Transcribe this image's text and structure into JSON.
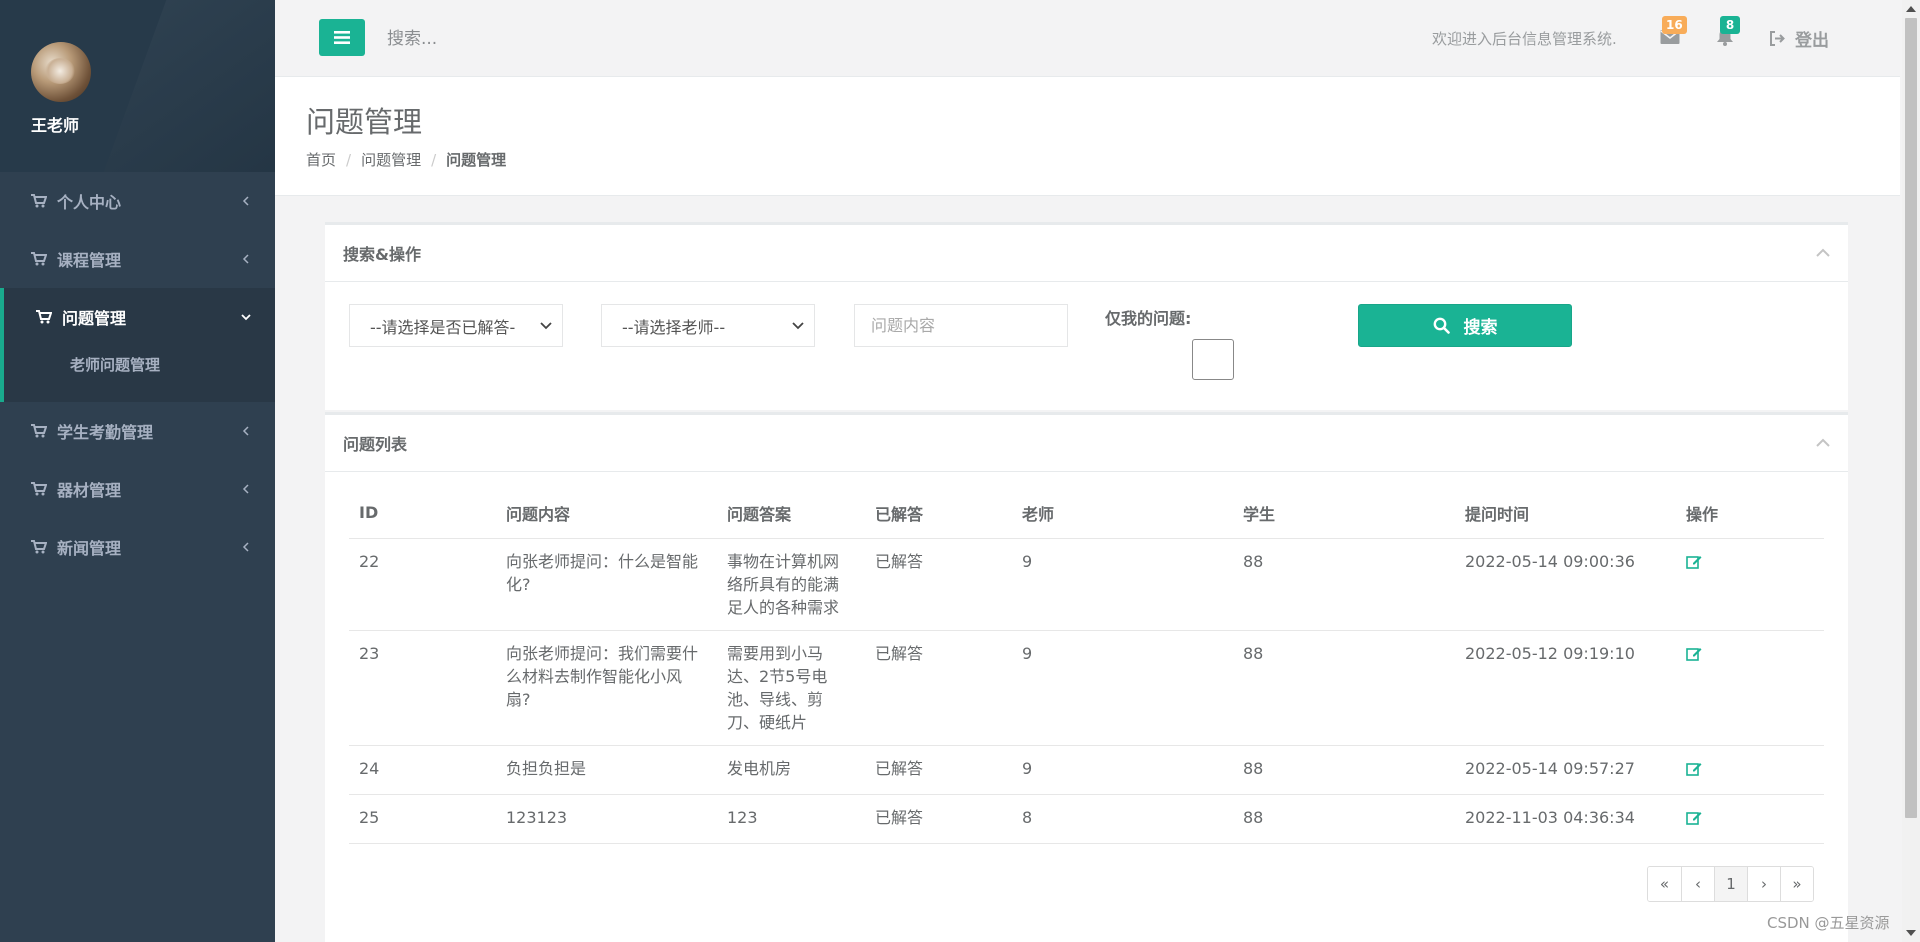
{
  "sidebar": {
    "user_name": "王老师",
    "items": [
      {
        "label": "个人中心"
      },
      {
        "label": "课程管理"
      },
      {
        "label": "问题管理"
      },
      {
        "label": "学生考勤管理"
      },
      {
        "label": "器材管理"
      },
      {
        "label": "新闻管理"
      }
    ],
    "active_sub": "老师问题管理"
  },
  "topbar": {
    "search_placeholder": "搜索...",
    "welcome": "欢迎进入后台信息管理系统.",
    "mail_count": "16",
    "notify_count": "8",
    "logout": "登出"
  },
  "heading": {
    "title": "问题管理",
    "breadcrumb": [
      "首页",
      "问题管理",
      "问题管理"
    ]
  },
  "search_panel": {
    "title": "搜索&操作",
    "answered_select": "--请选择是否已解答-",
    "teacher_select": "--请选择老师--",
    "content_placeholder": "问题内容",
    "only_mine_label": "仅我的问题:",
    "search_button": "搜索"
  },
  "list_panel": {
    "title": "问题列表",
    "columns": [
      "ID",
      "问题内容",
      "问题答案",
      "已解答",
      "老师",
      "学生",
      "提问时间",
      "操作"
    ],
    "rows": [
      {
        "id": "22",
        "question": "向张老师提问：什么是智能化?",
        "answer": "事物在计算机网络所具有的能满足人的各种需求",
        "answered": "已解答",
        "teacher": "9",
        "student": "88",
        "time": "2022-05-14 09:00:36"
      },
      {
        "id": "23",
        "question": "向张老师提问：我们需要什么材料去制作智能化小风扇?",
        "answer": "需要用到小马达、2节5号电池、导线、剪刀、硬纸片",
        "answered": "已解答",
        "teacher": "9",
        "student": "88",
        "time": "2022-05-12 09:19:10"
      },
      {
        "id": "24",
        "question": "负担负担是",
        "answer": "发电机房",
        "answered": "已解答",
        "teacher": "9",
        "student": "88",
        "time": "2022-05-14 09:57:27"
      },
      {
        "id": "25",
        "question": "123123",
        "answer": "123",
        "answered": "已解答",
        "teacher": "8",
        "student": "88",
        "time": "2022-11-03 04:36:34"
      }
    ],
    "pager": [
      "«",
      "‹",
      "1",
      "›",
      "»"
    ]
  },
  "watermark": "CSDN @五星资源",
  "colors": {
    "accent": "#1ab394",
    "sidebar": "#2f4050",
    "mail_badge": "#f8ac59",
    "notify_badge": "#1ab394"
  }
}
